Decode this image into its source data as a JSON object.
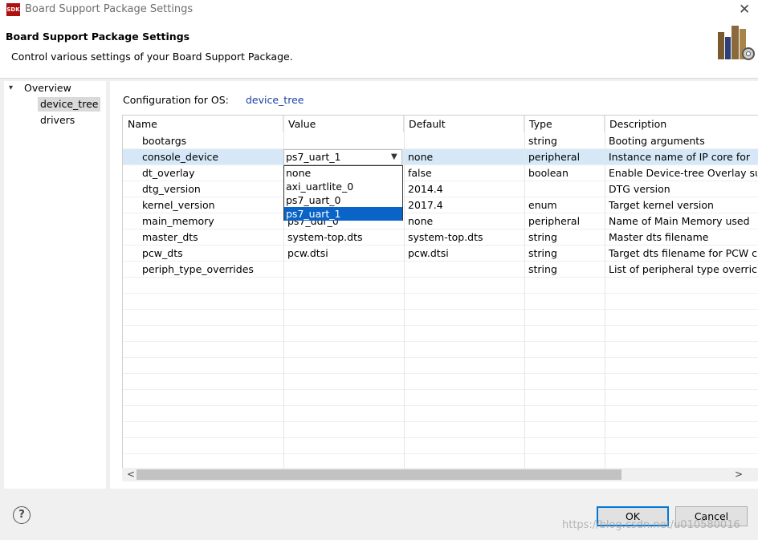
{
  "window": {
    "title": "Board Support Package Settings",
    "app_icon_text": "SDK"
  },
  "header": {
    "title": "Board Support Package Settings",
    "subtitle": "Control various settings of your Board Support Package."
  },
  "tree": {
    "root": "Overview",
    "children": [
      "device_tree",
      "drivers"
    ],
    "selected": "device_tree"
  },
  "config": {
    "label": "Configuration for OS:",
    "os": "device_tree"
  },
  "table": {
    "columns": [
      "Name",
      "Value",
      "Default",
      "Type",
      "Description"
    ],
    "rows": [
      {
        "name": "bootargs",
        "value": "",
        "default": "",
        "type": "string",
        "description": "Booting arguments"
      },
      {
        "name": "console_device",
        "value": "ps7_uart_1",
        "default": "none",
        "type": "peripheral",
        "description": "Instance name of IP core for"
      },
      {
        "name": "dt_overlay",
        "value": "",
        "default": "false",
        "type": "boolean",
        "description": "Enable Device-tree Overlay su"
      },
      {
        "name": "dtg_version",
        "value": "",
        "default": "2014.4",
        "type": "",
        "description": "DTG version"
      },
      {
        "name": "kernel_version",
        "value": "",
        "default": "2017.4",
        "type": "enum",
        "description": "Target kernel version"
      },
      {
        "name": "main_memory",
        "value": "ps7_ddr_0",
        "default": "none",
        "type": "peripheral",
        "description": "Name of Main Memory used"
      },
      {
        "name": "master_dts",
        "value": "system-top.dts",
        "default": "system-top.dts",
        "type": "string",
        "description": "Master dts filename"
      },
      {
        "name": "pcw_dts",
        "value": "pcw.dtsi",
        "default": "pcw.dtsi",
        "type": "string",
        "description": "Target dts filename for PCW c"
      },
      {
        "name": "periph_type_overrides",
        "value": "",
        "default": "",
        "type": "string",
        "description": "List of peripheral type overric"
      }
    ],
    "selected_row": "console_device"
  },
  "dropdown": {
    "current": "ps7_uart_1",
    "options": [
      "none",
      "axi_uartlite_0",
      "ps7_uart_0",
      "ps7_uart_1"
    ],
    "selected": "ps7_uart_1"
  },
  "buttons": {
    "ok": "OK",
    "cancel": "Cancel",
    "help": "?"
  },
  "watermark": "https://blog.csdn.net/u010580016",
  "colors": {
    "accent": "#0078d7",
    "selection": "#0a63c7",
    "row_highlight": "#d6e8f7",
    "link": "#1a3fa8"
  },
  "icons": {
    "close": "close-icon",
    "tree_toggle": "chevron-down-icon",
    "dropdown": "chevron-down-icon",
    "banner": "books-gear-icon"
  }
}
